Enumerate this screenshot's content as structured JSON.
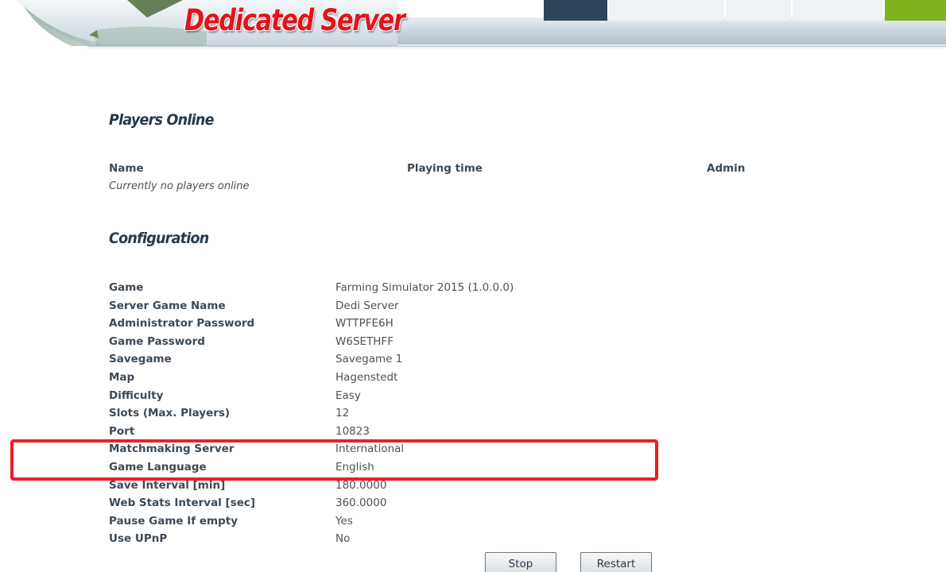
{
  "header": {
    "logo_text": "Dedicated Server",
    "nav_tab_colors": [
      "#2e4458",
      "#eef2f5",
      "#eef2f5",
      "#eef2f5",
      "#7fb21e"
    ]
  },
  "players": {
    "title": "Players Online",
    "columns": [
      "Name",
      "Playing time",
      "Admin"
    ],
    "empty_message": "Currently no players online"
  },
  "configuration": {
    "title": "Configuration",
    "rows": [
      {
        "label": "Game",
        "value": "Farming Simulator 2015 (1.0.0.0)"
      },
      {
        "label": "Server Game Name",
        "value": "Dedi Server"
      },
      {
        "label": "Administrator Password",
        "value": "WTTPFE6H"
      },
      {
        "label": "Game Password",
        "value": "W6SETHFF"
      },
      {
        "label": "Savegame",
        "value": "Savegame 1"
      },
      {
        "label": "Map",
        "value": "Hagenstedt"
      },
      {
        "label": "Difficulty",
        "value": "Easy"
      },
      {
        "label": "Slots (Max. Players)",
        "value": "12"
      },
      {
        "label": "Port",
        "value": "10823"
      },
      {
        "label": "Matchmaking Server",
        "value": "International"
      },
      {
        "label": "Game Language",
        "value": "English"
      },
      {
        "label": "Save Interval [min]",
        "value": "180.0000"
      },
      {
        "label": "Web Stats Interval [sec]",
        "value": "360.0000"
      },
      {
        "label": "Pause Game If empty",
        "value": "Yes"
      },
      {
        "label": "Use UPnP",
        "value": "No"
      }
    ]
  },
  "buttons": {
    "stop_label": "Stop",
    "restart_label": "Restart"
  },
  "highlight_color": "#ee1c25"
}
